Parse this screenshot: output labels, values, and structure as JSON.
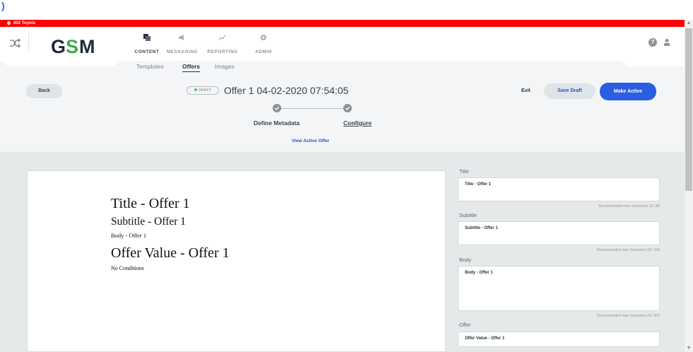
{
  "location": {
    "name": "802 Toyota"
  },
  "nav": {
    "items": [
      {
        "label": "CONTENT",
        "icon": "content-icon"
      },
      {
        "label": "MESSAGING",
        "icon": "megaphone-icon"
      },
      {
        "label": "REPORTING",
        "icon": "chart-icon"
      },
      {
        "label": "ADMIN",
        "icon": "gear-icon"
      }
    ],
    "active": "CONTENT"
  },
  "brand": {
    "logo_text": "GSM",
    "accent": "#2b5ee0",
    "logo_green": "#3fa84a",
    "logo_dark": "#1f2a36"
  },
  "subtabs": [
    "Templates",
    "Offers",
    "Images"
  ],
  "active_subtab": "Offers",
  "header": {
    "back_label": "Back",
    "status_badge": "DRAFT",
    "offer_title": "Offer 1 04-02-2020 07:54:05",
    "exit_label": "Exit",
    "save_draft_label": "Save Draft",
    "make_active_label": "Make Active"
  },
  "stepper": {
    "steps": [
      "Define Metadata",
      "Configure"
    ],
    "current": "Configure"
  },
  "view_active_label": "View Active Offer",
  "preview": {
    "title": "Title - Offer 1",
    "subtitle": "Subtitle - Offer 1",
    "body": "Body - Offer 1",
    "offer_value": "Offer Value - Offer 1",
    "conditions": "No Conditions"
  },
  "form": {
    "title": {
      "label": "Title",
      "value": "Title - Offer 1",
      "hint": "Recommended max characters 15 / 80"
    },
    "subtitle": {
      "label": "Subtitle",
      "value": "Subtitle - Offer 1",
      "hint": "Recommended max characters 18 / 160"
    },
    "body": {
      "label": "Body",
      "value": "Body - Offer 1",
      "hint": "Recommended max characters 14 / 300"
    },
    "offer": {
      "label": "Offer",
      "value": "Offer Value - Offer 1"
    }
  }
}
